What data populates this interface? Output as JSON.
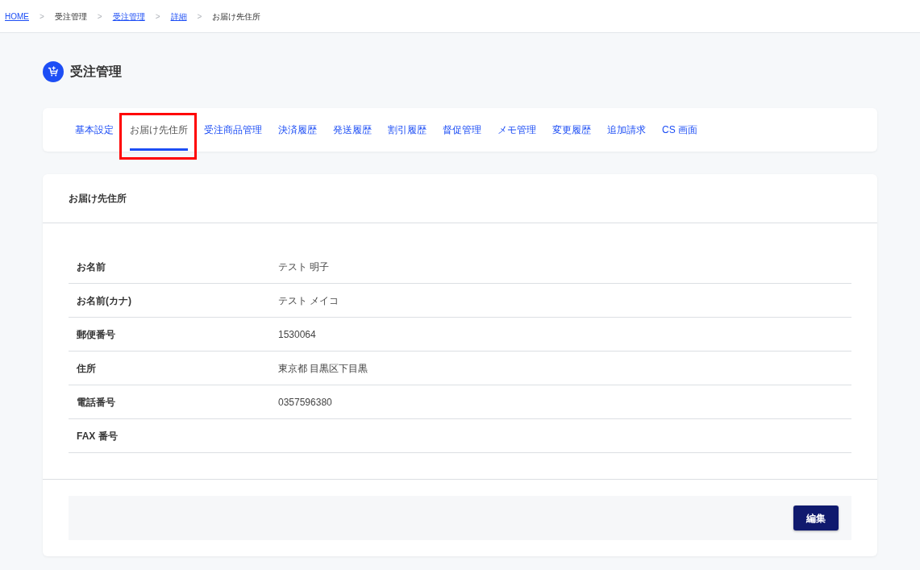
{
  "breadcrumb": {
    "items": [
      {
        "label": "HOME",
        "link": true
      },
      {
        "separator": ">",
        "label": "受注管理",
        "link": false
      },
      {
        "separator": ">",
        "label": "受注管理",
        "link": true
      },
      {
        "separator": ">",
        "label": "詳細",
        "link": true
      },
      {
        "separator": ">",
        "label": "お届け先住所",
        "link": false
      }
    ]
  },
  "page_title": "受注管理",
  "tabs": [
    {
      "label": "基本設定",
      "selected": false,
      "highlighted": false
    },
    {
      "label": "お届け先住所",
      "selected": true,
      "highlighted": true
    },
    {
      "label": "受注商品管理",
      "selected": false,
      "highlighted": false
    },
    {
      "label": "決済履歴",
      "selected": false,
      "highlighted": false
    },
    {
      "label": "発送履歴",
      "selected": false,
      "highlighted": false
    },
    {
      "label": "割引履歴",
      "selected": false,
      "highlighted": false
    },
    {
      "label": "督促管理",
      "selected": false,
      "highlighted": false
    },
    {
      "label": "メモ管理",
      "selected": false,
      "highlighted": false
    },
    {
      "label": "変更履歴",
      "selected": false,
      "highlighted": false
    },
    {
      "label": "追加請求",
      "selected": false,
      "highlighted": false
    },
    {
      "label": "CS 画面",
      "selected": false,
      "highlighted": false
    }
  ],
  "panel": {
    "title": "お届け先住所",
    "rows": [
      {
        "label": "お名前",
        "value": "テスト 明子"
      },
      {
        "label": "お名前(カナ)",
        "value": "テスト メイコ"
      },
      {
        "label": "郵便番号",
        "value": "1530064"
      },
      {
        "label": "住所",
        "value": "東京都 目黒区下目黒"
      },
      {
        "label": "電話番号",
        "value": "0357596380"
      },
      {
        "label": "FAX 番号"
      }
    ],
    "buttons": [
      {
        "label": "編集"
      }
    ]
  }
}
